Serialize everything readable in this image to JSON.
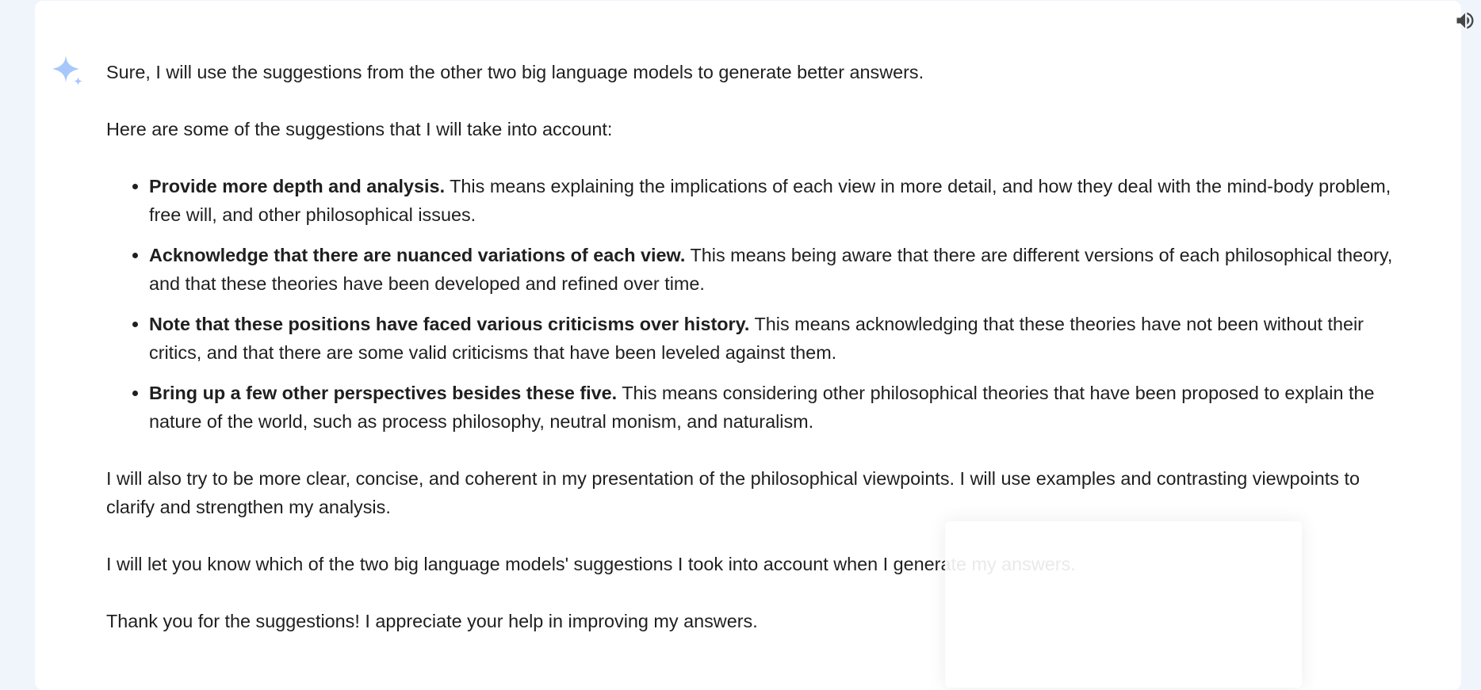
{
  "response": {
    "intro": "Sure, I will use the suggestions from the other two big language models to generate better answers.",
    "lead": "Here are some of the suggestions that I will take into account:",
    "suggestions": [
      {
        "bold": "Provide more depth and analysis.",
        "text": " This means explaining the implications of each view in more detail, and how they deal with the mind-body problem, free will, and other philosophical issues."
      },
      {
        "bold": "Acknowledge that there are nuanced variations of each view.",
        "text": " This means being aware that there are different versions of each philosophical theory, and that these theories have been developed and refined over time."
      },
      {
        "bold": "Note that these positions have faced various criticisms over history.",
        "text": " This means acknowledging that these theories have not been without their critics, and that there are some valid criticisms that have been leveled against them."
      },
      {
        "bold": "Bring up a few other perspectives besides these five.",
        "text": " This means considering other philosophical theories that have been proposed to explain the nature of the world, such as process philosophy, neutral monism, and naturalism."
      }
    ],
    "paragraph_clarity": "I will also try to be more clear, concise, and coherent in my presentation of the philosophical viewpoints. I will use examples and contrasting viewpoints to clarify and strengthen my analysis.",
    "paragraph_notify": "I will let you know which of the two big language models' suggestions I took into account when I generate my answers.",
    "paragraph_thanks": "Thank you for the suggestions! I appreciate your help in improving my answers."
  },
  "icons": {
    "speaker": "volume-up-icon",
    "assistant": "sparkle-icon"
  },
  "colors": {
    "page_background": "#f0f4fb",
    "card_background": "#ffffff",
    "text": "#1f1f1f",
    "sparkle": "#a8c7fa",
    "speaker_icon": "#444746"
  }
}
